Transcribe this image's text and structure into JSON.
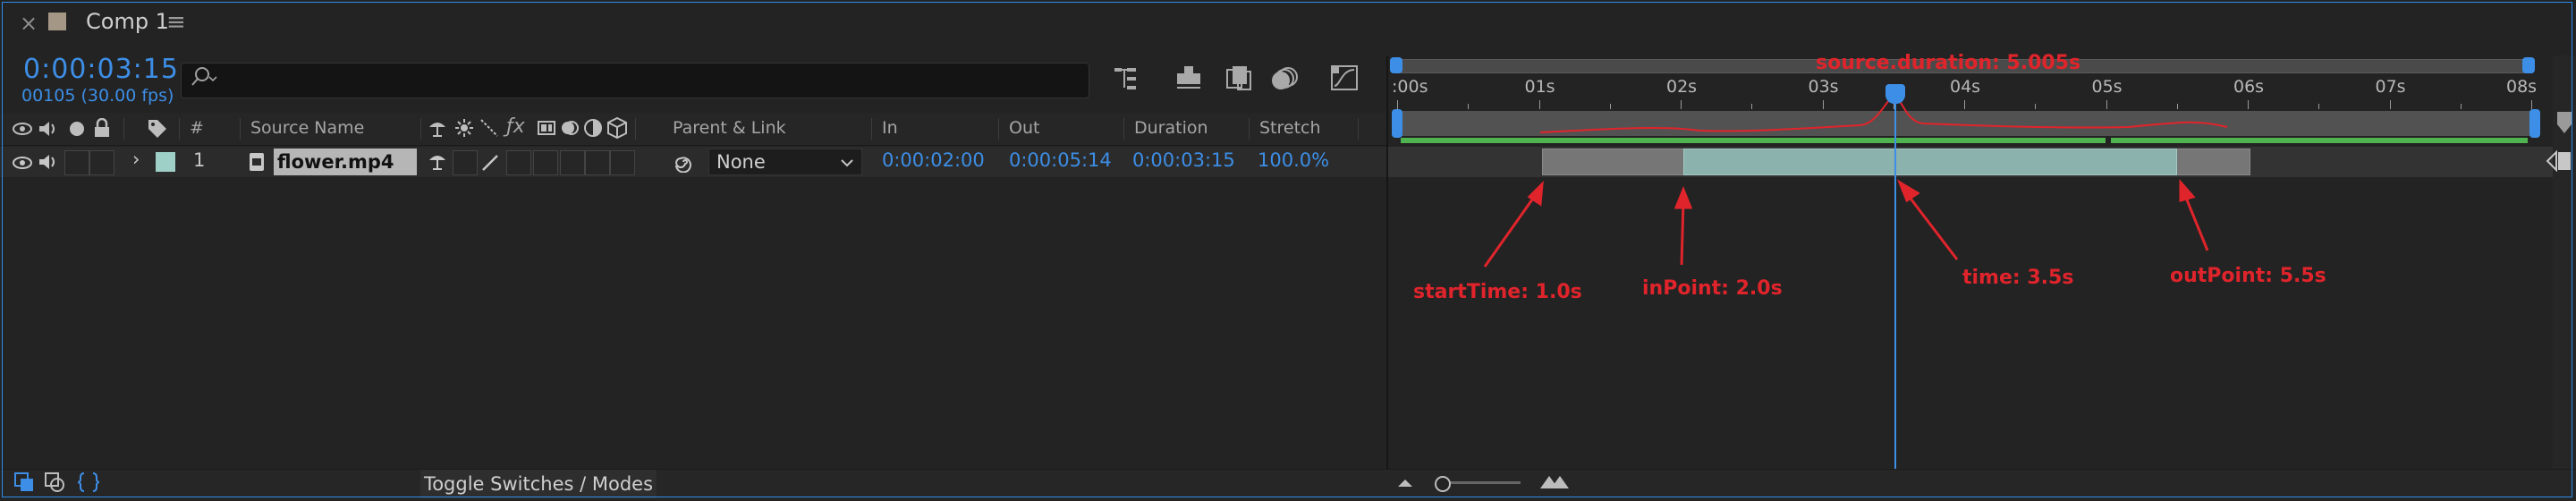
{
  "tab": {
    "close": "×",
    "title": "Comp 1",
    "menu": "≡"
  },
  "header": {
    "timecode": "0:00:03:15",
    "frames": "00105 (30.00 fps)",
    "search_placeholder": ""
  },
  "columns": {
    "number": "#",
    "source_name": "Source Name",
    "parent_link": "Parent & Link",
    "in": "In",
    "out": "Out",
    "duration": "Duration",
    "stretch": "Stretch"
  },
  "layer": {
    "index": "1",
    "name": "flower.mp4",
    "label_color": "#9fd0c8",
    "parent": "None",
    "in": "0:00:02:00",
    "out": "0:00:05:14",
    "duration": "0:00:03:15",
    "stretch": "100.0%"
  },
  "ruler": {
    "ticks": [
      ":00s",
      "01s",
      "02s",
      "03s",
      "04s",
      "05s",
      "06s",
      "07s",
      "08s"
    ]
  },
  "annotations": {
    "source_duration": "source.duration: 5.005s",
    "start_time": "startTime: 1.0s",
    "in_point": "inPoint: 2.0s",
    "time": "time: 3.5s",
    "out_point": "outPoint: 5.5s"
  },
  "footer": {
    "toggle": "Toggle Switches / Modes"
  },
  "colors": {
    "accent": "#3d8ee6",
    "annotation": "#e0242b",
    "active_bar": "#8bb2ad",
    "source_bar": "#767676",
    "green": "#4fb34f"
  }
}
